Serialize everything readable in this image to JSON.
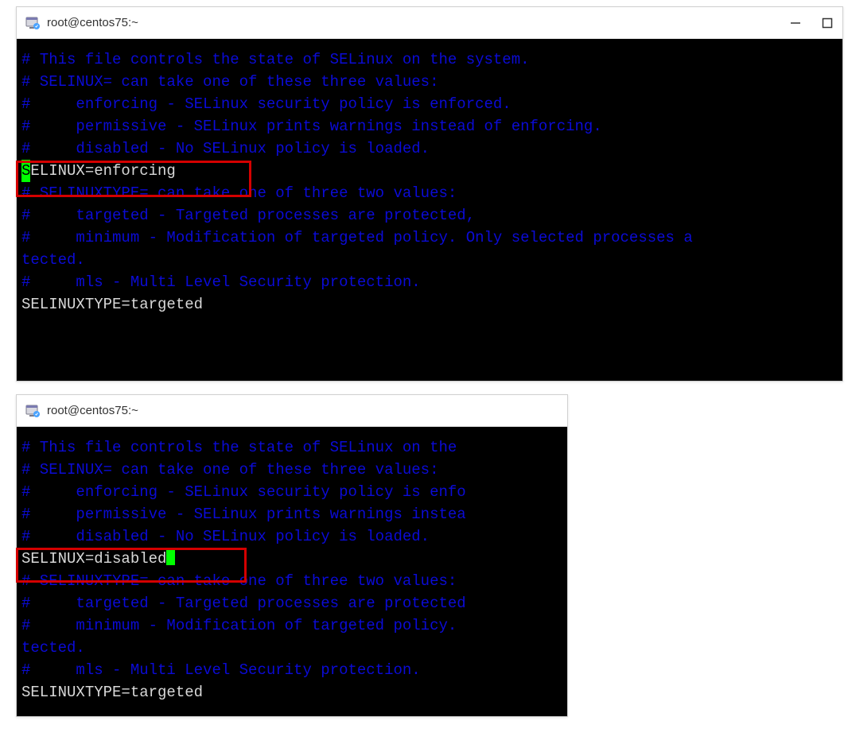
{
  "window1": {
    "title": "root@centos75:~",
    "terminal": {
      "l1": "# This file controls the state of SELinux on the system.",
      "l2": "# SELINUX= can take one of these three values:",
      "l3": "#     enforcing - SELinux security policy is enforced.",
      "l4": "#     permissive - SELinux prints warnings instead of enforcing.",
      "l5": "#     disabled - No SELinux policy is loaded.",
      "selinux_first_char": "S",
      "selinux_rest": "ELINUX=enforcing",
      "l7": "# SELINUXTYPE= can take one of three two values:",
      "l8": "#     targeted - Targeted processes are protected,",
      "l9": "#     minimum - Modification of targeted policy. Only selected processes a",
      "l10": "tected.",
      "l11": "#     mls - Multi Level Security protection.",
      "l12": "SELINUXTYPE=targeted"
    }
  },
  "window2": {
    "title": "root@centos75:~",
    "terminal": {
      "l1": "# This file controls the state of SELinux on the ",
      "l2": "# SELINUX= can take one of these three values:",
      "l3": "#     enforcing - SELinux security policy is enfo",
      "l4": "#     permissive - SELinux prints warnings instea",
      "l5": "#     disabled - No SELinux policy is loaded.",
      "selinux_line": "SELINUX=disabled",
      "l7": "# SELINUXTYPE= can take one of three two values:",
      "l8": "#     targeted - Targeted processes are protected",
      "l9": "#     minimum - Modification of targeted policy. ",
      "l10": "tected.",
      "l11": "#     mls - Multi Level Security protection.",
      "l12": "SELINUXTYPE=targeted"
    }
  }
}
